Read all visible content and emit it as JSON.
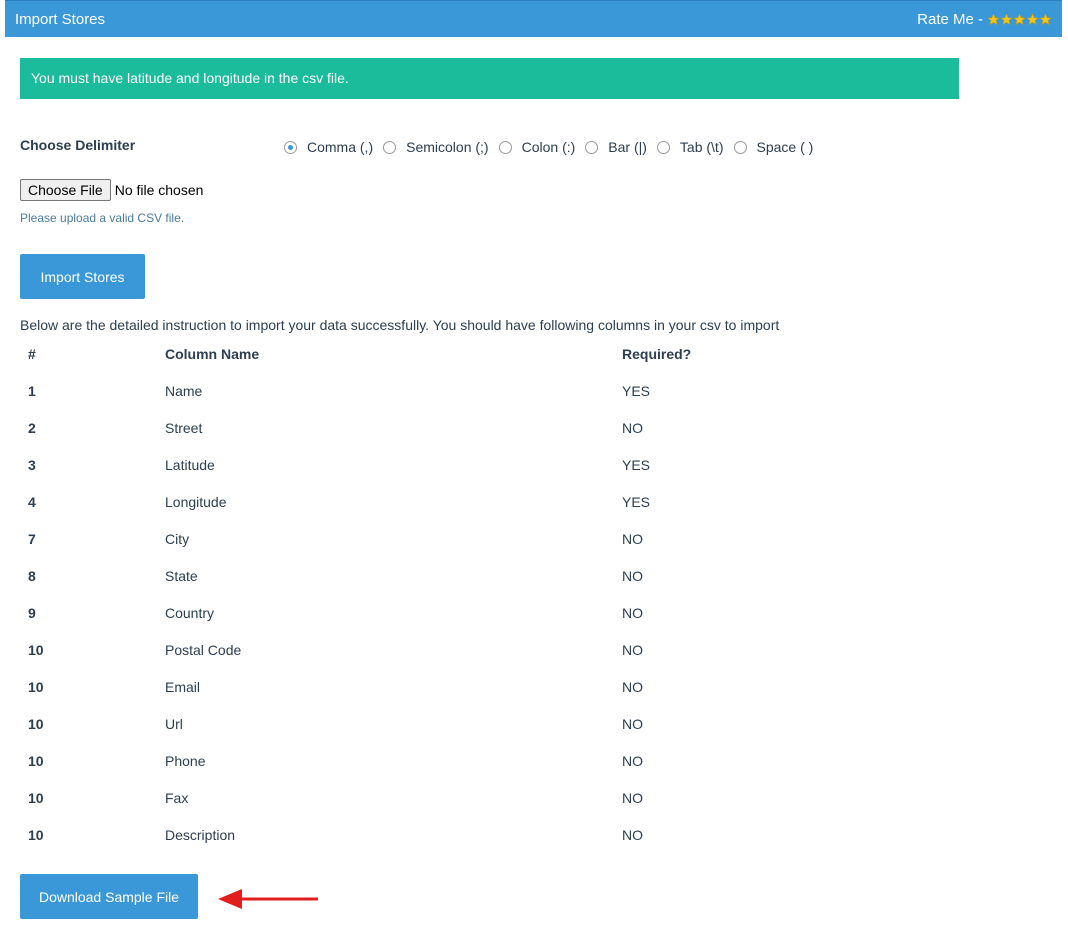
{
  "header": {
    "title": "Import Stores",
    "rate_label": "Rate Me -",
    "stars": 5,
    "star_color": "#f5c518"
  },
  "alert": {
    "message": "You must have latitude and longitude in the csv file."
  },
  "delimiter": {
    "label": "Choose Delimiter",
    "options": [
      {
        "label": "Comma (,)",
        "checked": true
      },
      {
        "label": "Semicolon (;)",
        "checked": false
      },
      {
        "label": "Colon (:)",
        "checked": false
      },
      {
        "label": "Bar (|)",
        "checked": false
      },
      {
        "label": "Tab (\\t)",
        "checked": false
      },
      {
        "label": "Space ( )",
        "checked": false
      }
    ]
  },
  "file": {
    "button_label": "Choose File",
    "status": "No file chosen",
    "help": "Please upload a valid CSV file."
  },
  "import_button": "Import Stores",
  "instruction": "Below are the detailed instruction to import your data successfully. You should have following columns in your csv to import",
  "table": {
    "headers": [
      "#",
      "Column Name",
      "Required?"
    ],
    "rows": [
      [
        "1",
        "Name",
        "YES"
      ],
      [
        "2",
        "Street",
        "NO"
      ],
      [
        "3",
        "Latitude",
        "YES"
      ],
      [
        "4",
        "Longitude",
        "YES"
      ],
      [
        "7",
        "City",
        "NO"
      ],
      [
        "8",
        "State",
        "NO"
      ],
      [
        "9",
        "Country",
        "NO"
      ],
      [
        "10",
        "Postal Code",
        "NO"
      ],
      [
        "10",
        "Email",
        "NO"
      ],
      [
        "10",
        "Url",
        "NO"
      ],
      [
        "10",
        "Phone",
        "NO"
      ],
      [
        "10",
        "Fax",
        "NO"
      ],
      [
        "10",
        "Description",
        "NO"
      ]
    ]
  },
  "download_button": "Download Sample File",
  "colors": {
    "primary": "#3a98d8",
    "success": "#1abc9c",
    "arrow": "#e11d1d"
  }
}
